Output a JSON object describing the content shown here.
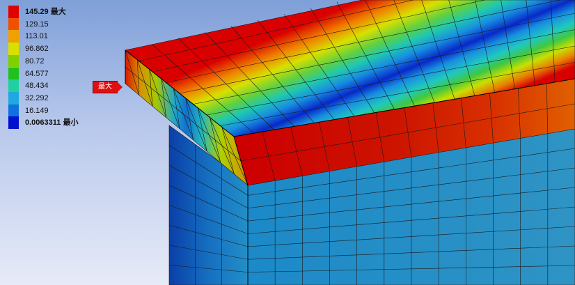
{
  "legend": {
    "entries": [
      {
        "label": "145.29 最大",
        "color": "#e00000",
        "bold": true
      },
      {
        "label": "129.15",
        "color": "#f05000",
        "bold": false
      },
      {
        "label": "113.01",
        "color": "#f0a000",
        "bold": false
      },
      {
        "label": "96.862",
        "color": "#d8e000",
        "bold": false
      },
      {
        "label": "80.72",
        "color": "#80d000",
        "bold": false
      },
      {
        "label": "64.577",
        "color": "#20c020",
        "bold": false
      },
      {
        "label": "48.434",
        "color": "#20d0a0",
        "bold": false
      },
      {
        "label": "32.292",
        "color": "#20a8e0",
        "bold": false
      },
      {
        "label": "16.149",
        "color": "#1070e0",
        "bold": false
      },
      {
        "label": "0.0063311 最小",
        "color": "#0010d0",
        "bold": true
      }
    ]
  },
  "probe": {
    "label": "最大",
    "color": "#e01010"
  },
  "colors": {
    "background_top": "#7f9fd8",
    "background_bottom": "#e7ebf8",
    "mesh_line": "#1a1a1a"
  }
}
